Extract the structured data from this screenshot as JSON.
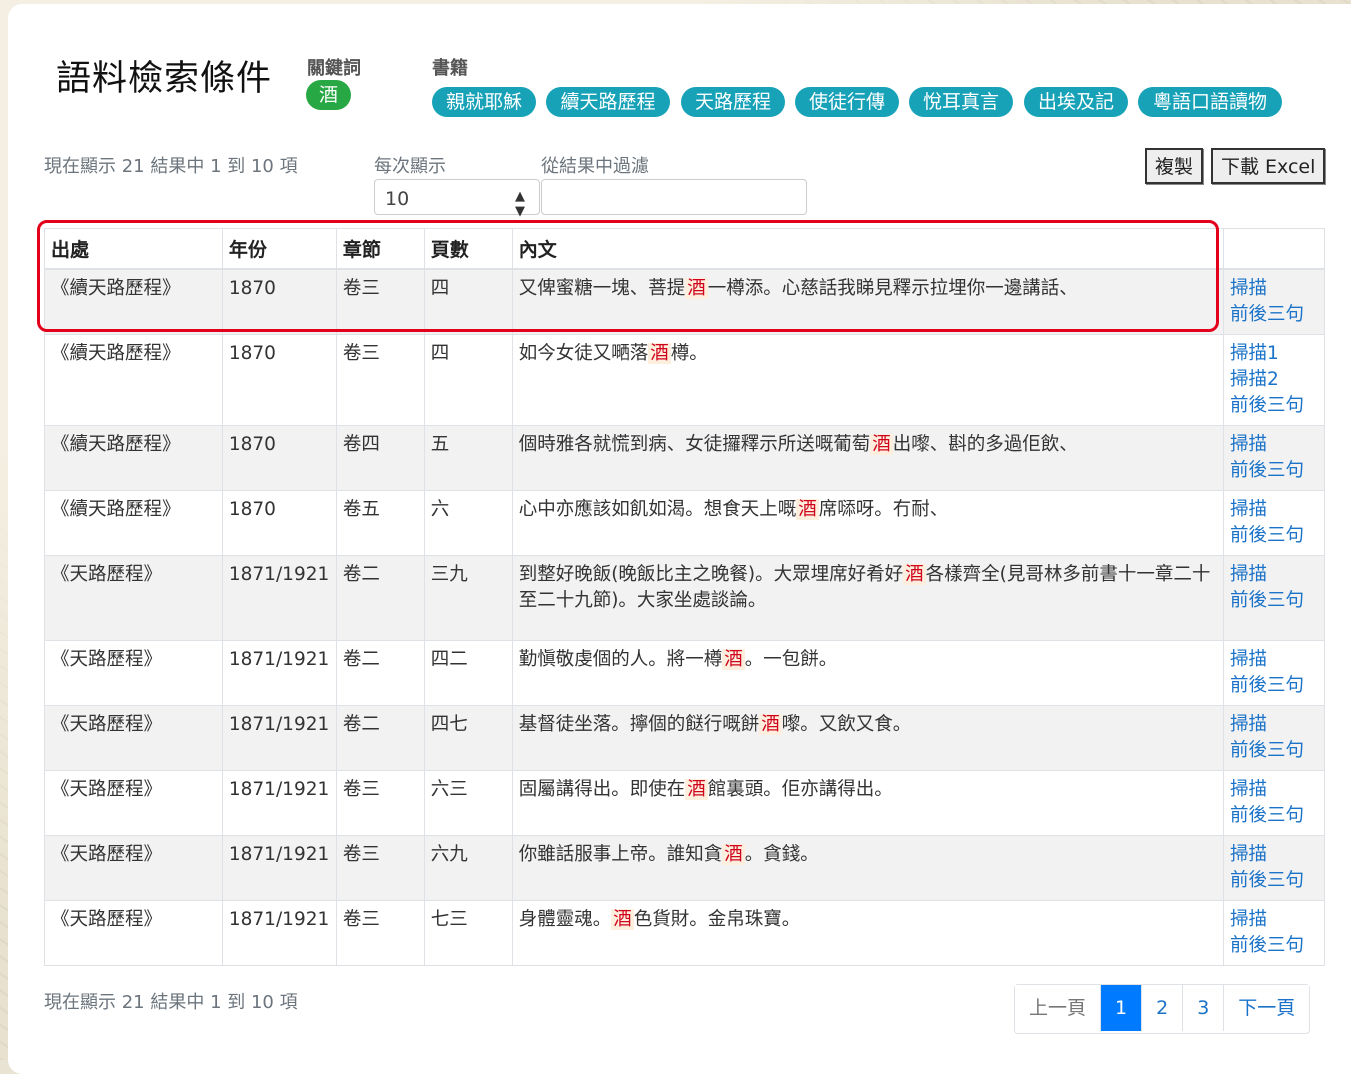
{
  "page_title": "語料檢索條件",
  "keyword": {
    "label": "關鍵詞",
    "value": "酒"
  },
  "books": {
    "label": "書籍",
    "items": [
      "親就耶穌",
      "續天路歷程",
      "天路歷程",
      "使徒行傳",
      "悅耳真言",
      "出埃及記",
      "粵語口語讀物"
    ]
  },
  "info_top": "現在顯示 21 結果中 1 到 10 項",
  "info_bottom": "現在顯示 21 結果中 1 到 10 項",
  "page_length": {
    "label": "每次顯示",
    "value": "10"
  },
  "filter": {
    "label": "從結果中過濾",
    "value": ""
  },
  "buttons": {
    "copy": "複製",
    "excel": "下載 Excel"
  },
  "table": {
    "headers": [
      "出處",
      "年份",
      "章節",
      "頁數",
      "內文",
      ""
    ],
    "rows": [
      {
        "source": "《續天路歷程》",
        "year": "1870",
        "chapter": "卷三",
        "page": "四",
        "pre": "又俾蜜糖一塊、菩提",
        "kw": "酒",
        "post": "一樽添。心慈話我睇見釋示拉埋你一邊講話、",
        "links": [
          "掃描",
          "前後三句"
        ]
      },
      {
        "source": "《續天路歷程》",
        "year": "1870",
        "chapter": "卷三",
        "page": "四",
        "pre": "如今女徒又嗮落",
        "kw": "酒",
        "post": "樽。",
        "links": [
          "掃描1",
          "掃描2",
          "前後三句"
        ]
      },
      {
        "source": "《續天路歷程》",
        "year": "1870",
        "chapter": "卷四",
        "page": "五",
        "pre": "個時雅各就慌到病、女徒攞釋示所送嘅葡萄",
        "kw": "酒",
        "post": "出嚟、斟的多過佢飲、",
        "links": [
          "掃描",
          "前後三句"
        ]
      },
      {
        "source": "《續天路歷程》",
        "year": "1870",
        "chapter": "卷五",
        "page": "六",
        "pre": "心中亦應該如飢如渴。想食天上嘅",
        "kw": "酒",
        "post": "席𠻹呀。冇耐、",
        "links": [
          "掃描",
          "前後三句"
        ]
      },
      {
        "source": "《天路歷程》",
        "year": "1871/1921",
        "chapter": "卷二",
        "page": "三九",
        "pre": "到整好晚飯(晚飯比主之晚餐)。大眾埋席好肴好",
        "kw": "酒",
        "post": "各樣齊全(見哥林多前書十一章二十至二十九節)。大家坐處談論。",
        "links": [
          "掃描",
          "前後三句"
        ]
      },
      {
        "source": "《天路歷程》",
        "year": "1871/1921",
        "chapter": "卷二",
        "page": "四二",
        "pre": "勤愼敬虔個的人。將一樽",
        "kw": "酒",
        "post": "。一包餅。",
        "links": [
          "掃描",
          "前後三句"
        ]
      },
      {
        "source": "《天路歷程》",
        "year": "1871/1921",
        "chapter": "卷二",
        "page": "四七",
        "pre": "基督徒坐落。擰個的餸行嘅餅",
        "kw": "酒",
        "post": "嚟。又飲又食。",
        "links": [
          "掃描",
          "前後三句"
        ]
      },
      {
        "source": "《天路歷程》",
        "year": "1871/1921",
        "chapter": "卷三",
        "page": "六三",
        "pre": "固屬講得出。即使在",
        "kw": "酒",
        "post": "館裏頭。佢亦講得出。",
        "links": [
          "掃描",
          "前後三句"
        ]
      },
      {
        "source": "《天路歷程》",
        "year": "1871/1921",
        "chapter": "卷三",
        "page": "六九",
        "pre": "你雖話服事上帝。誰知貪",
        "kw": "酒",
        "post": "。貪錢。",
        "links": [
          "掃描",
          "前後三句"
        ]
      },
      {
        "source": "《天路歷程》",
        "year": "1871/1921",
        "chapter": "卷三",
        "page": "七三",
        "pre": "身體靈魂。",
        "kw": "酒",
        "post": "色貨財。金帛珠寶。",
        "links": [
          "掃描",
          "前後三句"
        ]
      }
    ]
  },
  "pagination": {
    "prev": "上一頁",
    "pages": [
      "1",
      "2",
      "3"
    ],
    "active": "1",
    "next": "下一頁"
  },
  "colors": {
    "keyword_badge": "#28a745",
    "book_badge": "#17a2b8",
    "highlight_text": "#d0021b",
    "active_page": "#007bff",
    "annotation_box": "#e3001b"
  }
}
